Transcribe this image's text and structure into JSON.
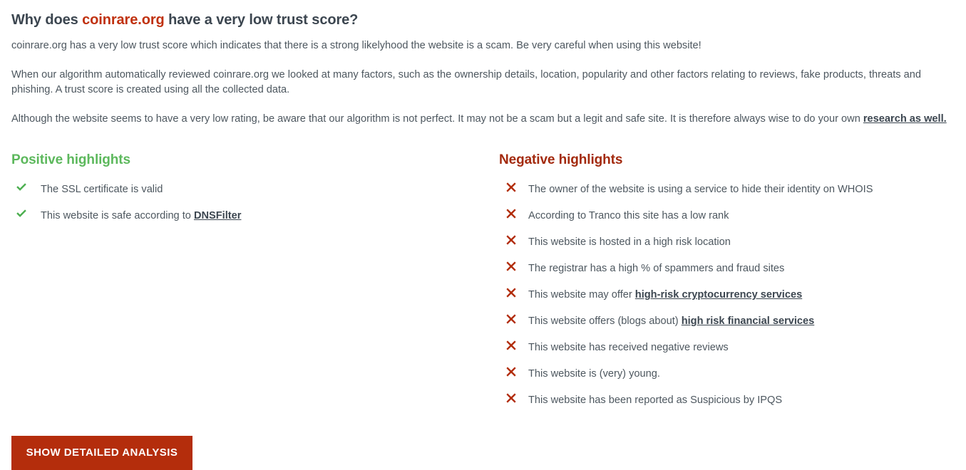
{
  "heading": {
    "prefix": "Why does ",
    "brand": "coinrare.org",
    "suffix": " have a very low trust score?"
  },
  "intro": {
    "paragraph_1": "coinrare.org has a very low trust score which indicates that there is a strong likelyhood the website is a scam. Be very careful when using this website!",
    "paragraph_2": "When our algorithm automatically reviewed coinrare.org we looked at many factors, such as the ownership details, location, popularity and other factors relating to reviews, fake products, threats and phishing. A trust score is created using all the collected data.",
    "paragraph_3_before_link": "Although the website seems to have a very low rating, be aware that our algorithm is not perfect. It may not be a scam but a legit and safe site. It is therefore always wise to do your own ",
    "paragraph_3_link": "research as well."
  },
  "positive": {
    "title": "Positive highlights",
    "icon": "check-icon",
    "color": "#5cb85c",
    "items": [
      {
        "text_before": "The SSL certificate is valid",
        "link": "",
        "text_after": ""
      },
      {
        "text_before": "This website is safe according to ",
        "link": "DNSFilter",
        "text_after": ""
      }
    ]
  },
  "negative": {
    "title": "Negative highlights",
    "icon": "times-icon",
    "color": "#a32a0e",
    "items": [
      {
        "text_before": "The owner of the website is using a service to hide their identity on WHOIS",
        "link": "",
        "text_after": ""
      },
      {
        "text_before": "According to Tranco this site has a low rank",
        "link": "",
        "text_after": ""
      },
      {
        "text_before": "This website is hosted in a high risk location",
        "link": "",
        "text_after": ""
      },
      {
        "text_before": "The registrar has a high % of spammers and fraud sites",
        "link": "",
        "text_after": ""
      },
      {
        "text_before": "This website may offer ",
        "link": "high-risk cryptocurrency services",
        "text_after": ""
      },
      {
        "text_before": "This website offers (blogs about) ",
        "link": "high risk financial services",
        "text_after": ""
      },
      {
        "text_before": "This website has received negative reviews",
        "link": "",
        "text_after": ""
      },
      {
        "text_before": "This website is (very) young.",
        "link": "",
        "text_after": ""
      },
      {
        "text_before": "This website has been reported as Suspicious by IPQS",
        "link": "",
        "text_after": ""
      }
    ]
  },
  "cta": {
    "label": "Show detailed analysis"
  }
}
